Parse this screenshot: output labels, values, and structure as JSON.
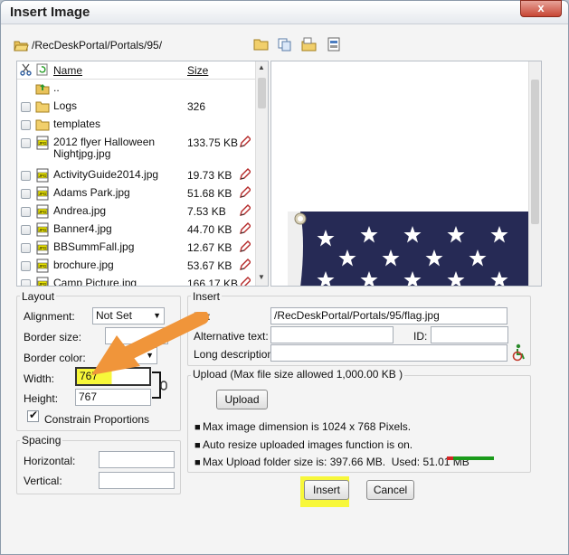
{
  "dialog": {
    "title": "Insert Image",
    "close_symbol": "x"
  },
  "toolbar": {
    "path": "/RecDeskPortal/Portals/95/",
    "icons": [
      "new-folder-icon",
      "copy-icon",
      "paste-folder-icon",
      "properties-icon"
    ]
  },
  "file_list": {
    "headers": {
      "name": "Name",
      "size": "Size"
    },
    "up_label": "..",
    "rows": [
      {
        "name": "Logs",
        "size": "326",
        "type": "folder"
      },
      {
        "name": "templates",
        "size": "",
        "type": "folder"
      },
      {
        "name": "2012 flyer Halloween Nightjpg.jpg",
        "size": "133.75 KB",
        "type": "jpg"
      },
      {
        "name": "ActivityGuide2014.jpg",
        "size": "19.73 KB",
        "type": "jpg"
      },
      {
        "name": "Adams Park.jpg",
        "size": "51.68 KB",
        "type": "jpg"
      },
      {
        "name": "Andrea.jpg",
        "size": "7.53 KB",
        "type": "jpg"
      },
      {
        "name": "Banner4.jpg",
        "size": "44.70 KB",
        "type": "jpg"
      },
      {
        "name": "BBSummFall.jpg",
        "size": "12.67 KB",
        "type": "jpg"
      },
      {
        "name": "brochure.jpg",
        "size": "53.67 KB",
        "type": "jpg"
      },
      {
        "name": "Camp Picture.jpg",
        "size": "166.17 KB",
        "type": "jpg"
      }
    ]
  },
  "layout": {
    "legend": "Layout",
    "alignment_label": "Alignment:",
    "alignment_value": "Not Set",
    "border_size_label": "Border size:",
    "border_size_value": "",
    "border_color_label": "Border color:",
    "width_label": "Width:",
    "width_value": "767",
    "height_label": "Height:",
    "height_value": "767",
    "constrain_label": "Constrain Proportions",
    "constrain_checked": true
  },
  "spacing": {
    "legend": "Spacing",
    "horizontal_label": "Horizontal:",
    "horizontal_value": "",
    "vertical_label": "Vertical:",
    "vertical_value": ""
  },
  "insert": {
    "legend": "Insert",
    "url_label": "Url:",
    "url_value": "/RecDeskPortal/Portals/95/flag.jpg",
    "alt_label": "Alternative text:",
    "alt_value": "",
    "id_label": "ID:",
    "id_value": "",
    "longdesc_label": "Long description:",
    "longdesc_value": ""
  },
  "upload": {
    "legend": "Upload (Max file size allowed 1,000.00 KB )",
    "button_label": "Upload",
    "info": [
      "Max image dimension is 1024 x 768 Pixels.",
      "Auto resize uploaded images function is on.",
      "Max Upload folder size is: 397.66 MB.  Used: 51.01 MB"
    ],
    "used_fraction": 0.128
  },
  "actions": {
    "insert_label": "Insert",
    "cancel_label": "Cancel"
  },
  "colors": {
    "highlight": "#f7f73a",
    "annotation_arrow": "#f0953a",
    "usage_bar": "#d32626",
    "free_bar": "#1a9a1a"
  }
}
